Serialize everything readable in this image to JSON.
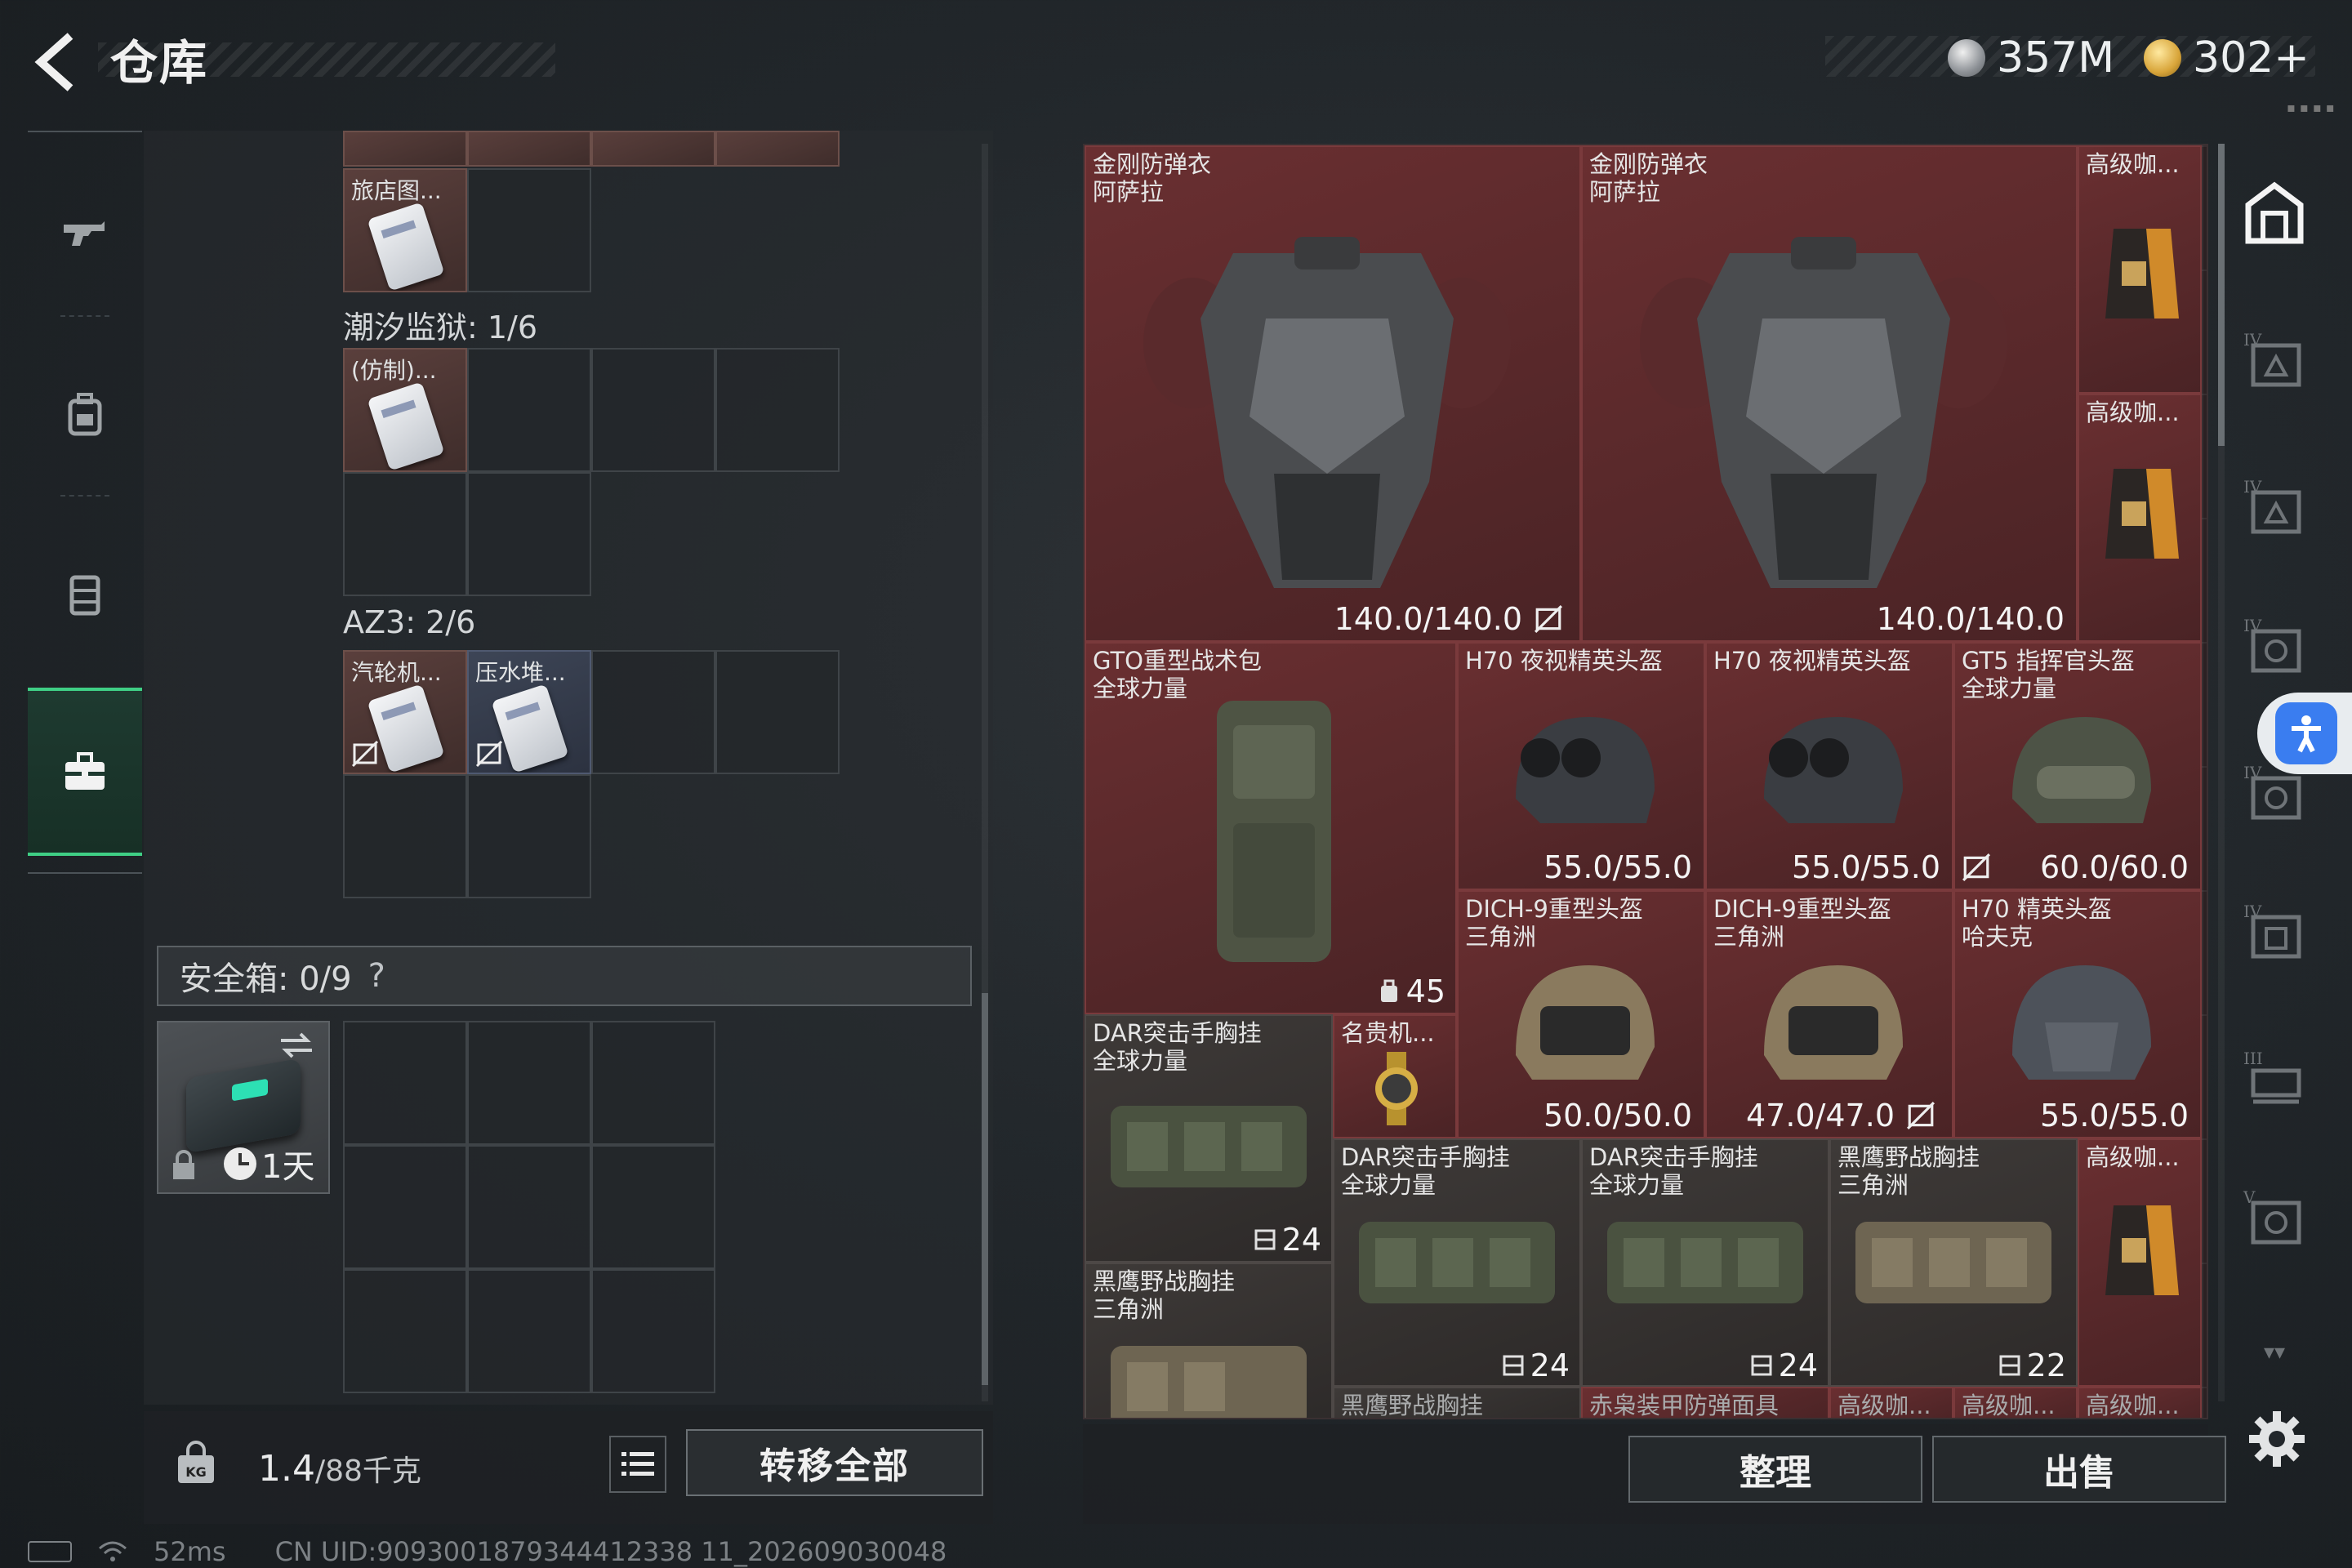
{
  "header": {
    "title": "仓库",
    "currencies": [
      {
        "icon": "silver-coin-icon",
        "value": "357M"
      },
      {
        "icon": "gold-coin-icon",
        "value": "302+"
      }
    ]
  },
  "left_nav": {
    "items": [
      "gun-icon",
      "backpack-icon",
      "vest-icon",
      "toolbox-icon"
    ],
    "active_index": 3
  },
  "inventory": {
    "item_top": {
      "name": "旅店图..."
    },
    "section_1": {
      "label": "潮汐监狱: 1/6",
      "item": {
        "name": "(仿制)..."
      }
    },
    "section_2": {
      "label": "AZ3: 2/6",
      "items": [
        {
          "name": "汽轮机..."
        },
        {
          "name": "压水堆..."
        }
      ]
    },
    "safebox": {
      "label": "安全箱: 0/9",
      "help": "?",
      "timer": "1天"
    }
  },
  "bottom_left": {
    "weight_value": "1.4",
    "weight_max": "/88千克",
    "transfer_label": "转移全部"
  },
  "status_bar": {
    "ping": "52ms",
    "uid": "CN UID:9093001879344412338 11_202609030048"
  },
  "stash": {
    "items": [
      {
        "name": "金刚防弹衣\n阿萨拉",
        "durability": "140.0/140.0"
      },
      {
        "name": "金刚防弹衣\n阿萨拉",
        "durability": "140.0/140.0"
      },
      {
        "name": "高级咖..."
      },
      {
        "name": "高级咖..."
      },
      {
        "name": "GTO重型战术包\n全球力量",
        "capacity": "45"
      },
      {
        "name": "H70 夜视精英头盔",
        "durability": "55.0/55.0"
      },
      {
        "name": "H70 夜视精英头盔",
        "durability": "55.0/55.0"
      },
      {
        "name": "GT5 指挥官头盔\n全球力量",
        "durability": "60.0/60.0"
      },
      {
        "name": "DICH-9重型头盔\n三角洲",
        "durability": "50.0/50.0"
      },
      {
        "name": "DICH-9重型头盔\n三角洲",
        "durability": "47.0/47.0"
      },
      {
        "name": "H70 精英头盔\n哈夫克",
        "durability": "55.0/55.0"
      },
      {
        "name": "DAR突击手胸挂\n全球力量",
        "capacity": "24"
      },
      {
        "name": "名贵机..."
      },
      {
        "name": "DAR突击手胸挂\n全球力量",
        "capacity": "24"
      },
      {
        "name": "DAR突击手胸挂\n全球力量",
        "capacity": "24"
      },
      {
        "name": "黑鹰野战胸挂\n三角洲",
        "capacity": "22"
      },
      {
        "name": "高级咖..."
      },
      {
        "name": "黑鹰野战胸挂\n三角洲"
      }
    ],
    "bottom_row_labels": [
      "黑鹰野战胸挂",
      "赤枭装甲防弹面具",
      "高级咖...",
      "高级咖...",
      "高级咖..."
    ]
  },
  "bottom_right": {
    "sort_label": "整理",
    "sell_label": "出售"
  },
  "right_nav": {
    "items": [
      "stash-icon",
      "armor-tier-4-icon",
      "armor-tier-4-icon",
      "helmet-tier-4-icon",
      "helmet-tier-4-icon",
      "backpack-tier-4-icon",
      "rig-tier-3-icon",
      "helmet-tier-5-icon"
    ]
  },
  "colors": {
    "accent_green": "#3fcf85",
    "item_red": "#6a2f31",
    "item_gray": "#3e3a38",
    "accessibility_blue": "#3a7df0"
  }
}
